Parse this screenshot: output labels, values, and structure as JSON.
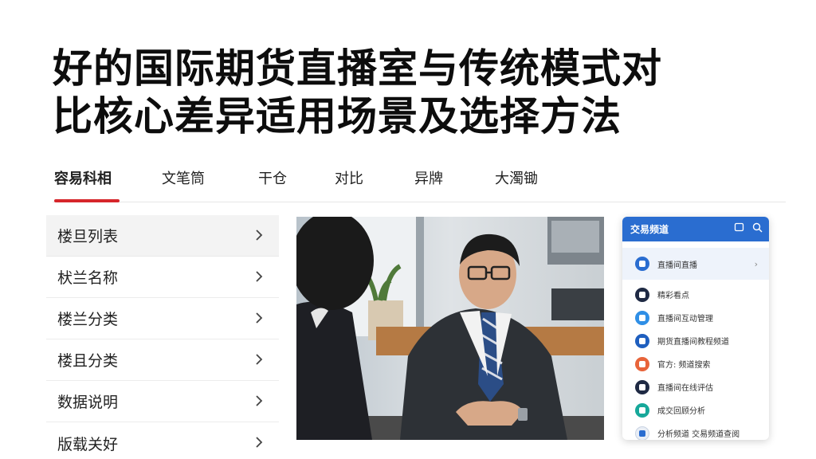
{
  "title": {
    "line1": "好的国际期货直播室与传统模式对",
    "line2": "比核心差异适用场景及选择方法"
  },
  "tabs": [
    {
      "label": "容易科相",
      "active": true
    },
    {
      "label": "文笔筒",
      "active": false
    },
    {
      "label": "干仓",
      "active": false
    },
    {
      "label": "对比",
      "active": false
    },
    {
      "label": "异牌",
      "active": false
    },
    {
      "label": "大濁锄",
      "active": false
    }
  ],
  "accent_color": "#d6262b",
  "menu": [
    {
      "label": "楼旦列表"
    },
    {
      "label": "枤兰名称"
    },
    {
      "label": "楼兰分类"
    },
    {
      "label": "楼且分类"
    },
    {
      "label": "数据说明"
    },
    {
      "label": "版载关好"
    }
  ],
  "photo": {
    "icon": "meeting-photo"
  },
  "panel": {
    "header_title": "交易频道",
    "header_color": "#2a6dd0",
    "rows": [
      {
        "label": "直播间直播",
        "icon_color": "#2a6dd0",
        "icon": "dot-icon"
      },
      {
        "label": "精彩看点",
        "icon_color": "#1f2a44",
        "icon": "dot-icon"
      },
      {
        "label": "直播间互动管理",
        "icon_color": "#2f8fe6",
        "icon": "chat-icon"
      },
      {
        "label": "期货直播间教程频道",
        "icon_color": "#1f5fbf",
        "icon": "grid-icon"
      },
      {
        "label": "官方: 频道搜索",
        "icon_color": "#e8643a",
        "icon": "flag-icon"
      },
      {
        "label": "直播间在线评估",
        "icon_color": "#1f2a44",
        "icon": "dot-icon"
      },
      {
        "label": "成交回顾分析",
        "icon_color": "#17a89a",
        "icon": "circle-icon"
      },
      {
        "label": "分析频道  交易频道查阅",
        "icon_color": "#e9eef6",
        "icon": "book-icon"
      }
    ]
  }
}
